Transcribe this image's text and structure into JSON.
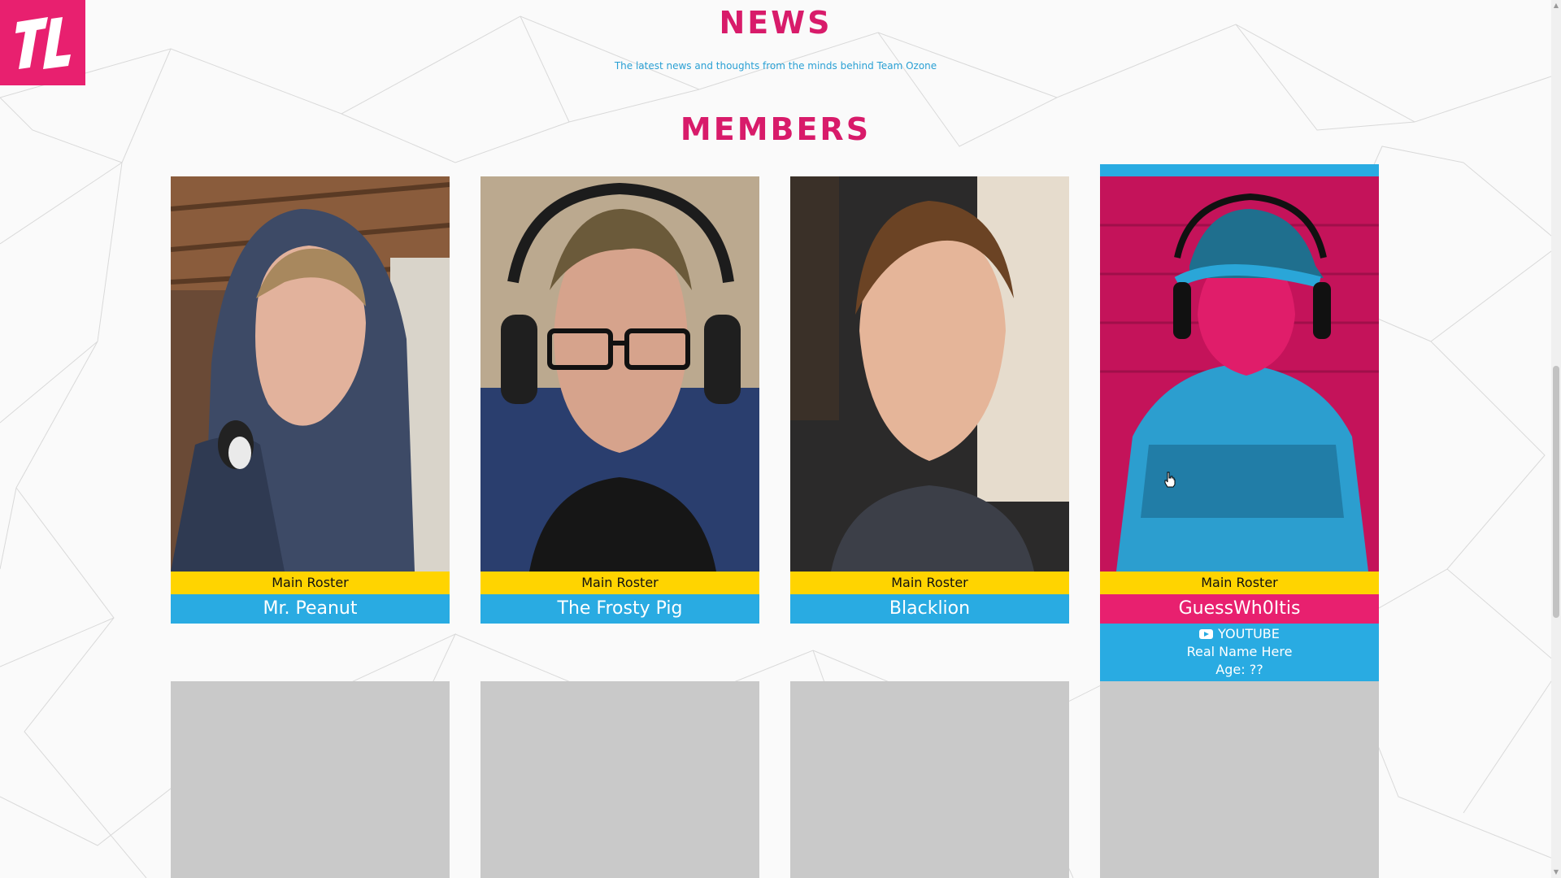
{
  "brand": {
    "logo_text": "TL",
    "accent": "#e8206f"
  },
  "news": {
    "title": "NEWS",
    "subtitle": "The latest news and thoughts from the minds behind Team Ozone"
  },
  "members": {
    "title": "MEMBERS",
    "cards": [
      {
        "role": "Main Roster",
        "name": "Mr. Peanut"
      },
      {
        "role": "Main Roster",
        "name": "The Frosty Pig"
      },
      {
        "role": "Main Roster",
        "name": "Blacklion"
      },
      {
        "role": "Main Roster",
        "name": "GuessWh0Itis",
        "link_label": "YOUTUBE",
        "real_name": "Real Name Here",
        "age": "Age: ??"
      }
    ]
  },
  "colors": {
    "pink": "#e8206f",
    "blue": "#29abe2",
    "yellow": "#ffd400",
    "placeholder_gray": "#c9c9c9"
  }
}
